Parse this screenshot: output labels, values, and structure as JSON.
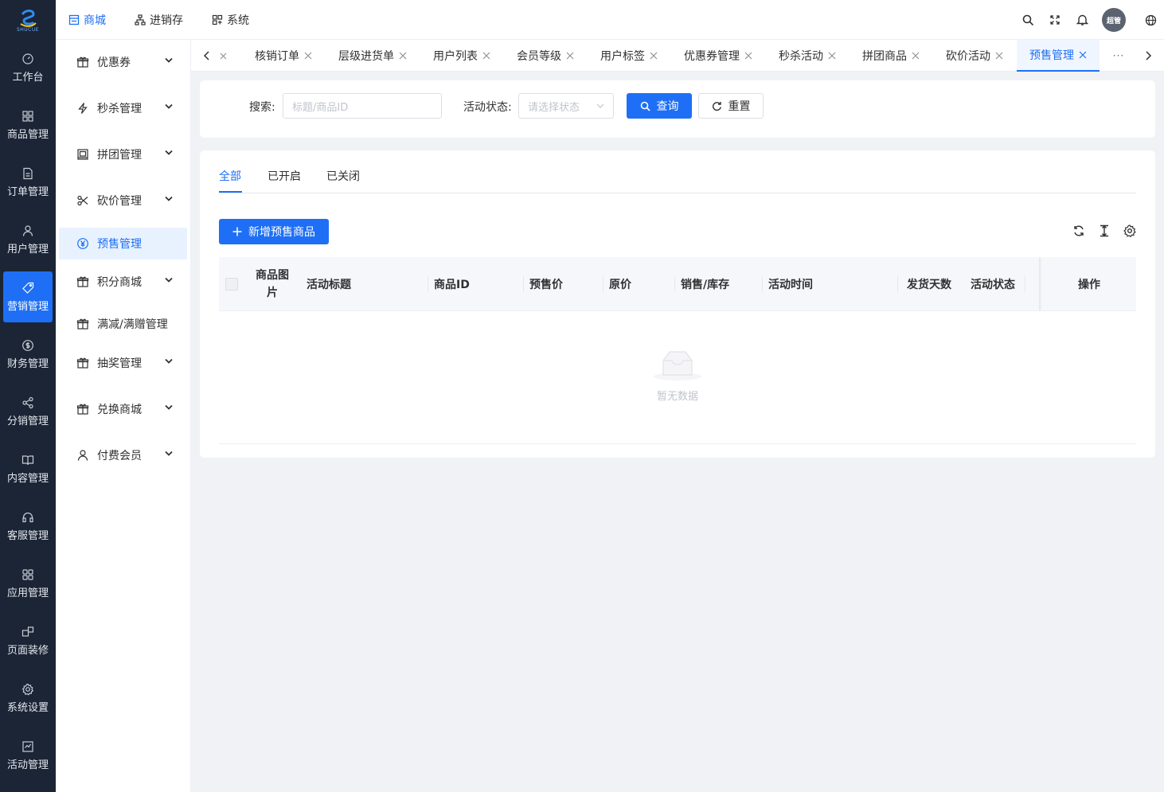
{
  "brand": {
    "logo_text": "SHUCUE",
    "primary_color": "#1e6ff5",
    "rail_color": "#1b2536"
  },
  "rail": {
    "items": [
      {
        "label": "工作台",
        "icon": "dashboard-icon"
      },
      {
        "label": "商品管理",
        "icon": "grid-icon"
      },
      {
        "label": "订单管理",
        "icon": "document-icon"
      },
      {
        "label": "用户管理",
        "icon": "user-icon"
      },
      {
        "label": "营销管理",
        "icon": "tag-icon"
      },
      {
        "label": "财务管理",
        "icon": "dollar-icon"
      },
      {
        "label": "分销管理",
        "icon": "share-icon"
      },
      {
        "label": "内容管理",
        "icon": "book-icon"
      },
      {
        "label": "客服管理",
        "icon": "headset-icon"
      },
      {
        "label": "应用管理",
        "icon": "apps-icon"
      },
      {
        "label": "页面装修",
        "icon": "layout-icon"
      },
      {
        "label": "系统设置",
        "icon": "gear-icon"
      },
      {
        "label": "活动管理",
        "icon": "activity-icon"
      }
    ],
    "active": "营销管理"
  },
  "topnav": {
    "items": [
      {
        "label": "商城",
        "icon": "store-icon"
      },
      {
        "label": "进销存",
        "icon": "sitemap-icon"
      },
      {
        "label": "系统",
        "icon": "system-icon"
      }
    ],
    "active": "商城"
  },
  "header_right": {
    "avatar_text": "超管",
    "icons": [
      "search-icon",
      "fullscreen-icon",
      "bell-icon",
      "globe-icon"
    ]
  },
  "subnav": {
    "items": [
      {
        "label": "优惠券",
        "icon": "gift-icon",
        "expandable": true
      },
      {
        "label": "秒杀管理",
        "icon": "lightning-icon",
        "expandable": true
      },
      {
        "label": "拼团管理",
        "icon": "group-icon",
        "expandable": true
      },
      {
        "label": "砍价管理",
        "icon": "scissors-icon",
        "expandable": true
      },
      {
        "label": "预售管理",
        "icon": "yen-icon",
        "expandable": false
      },
      {
        "label": "积分商城",
        "icon": "gift-icon",
        "expandable": true
      },
      {
        "label": "满减/满赠管理",
        "icon": "gift-icon",
        "expandable": false
      },
      {
        "label": "抽奖管理",
        "icon": "gift-icon",
        "expandable": true
      },
      {
        "label": "兑换商城",
        "icon": "gift-icon",
        "expandable": true
      },
      {
        "label": "付费会员",
        "icon": "user-icon",
        "expandable": true
      }
    ],
    "active": "预售管理"
  },
  "tabs": {
    "items": [
      "核销订单",
      "层级进货单",
      "用户列表",
      "会员等级",
      "用户标签",
      "优惠券管理",
      "秒杀活动",
      "拼团商品",
      "砍价活动",
      "预售管理"
    ],
    "active": "预售管理",
    "more": "···"
  },
  "search": {
    "keyword_label": "搜索:",
    "keyword_placeholder": "标题/商品ID",
    "status_label": "活动状态:",
    "status_placeholder": "请选择状态",
    "query_button": "查询",
    "reset_button": "重置"
  },
  "status_tabs": {
    "items": [
      "全部",
      "已开启",
      "已关闭"
    ],
    "active": "全部"
  },
  "toolbar": {
    "add_button": "新增预售商品",
    "icons": [
      "refresh-icon",
      "column-height-icon",
      "settings-icon"
    ]
  },
  "table": {
    "columns": [
      "商品图片",
      "活动标题",
      "商品ID",
      "预售价",
      "原价",
      "销售/库存",
      "活动时间",
      "发货天数",
      "活动状态",
      "操作"
    ],
    "rows": [],
    "empty_text": "暂无数据"
  }
}
